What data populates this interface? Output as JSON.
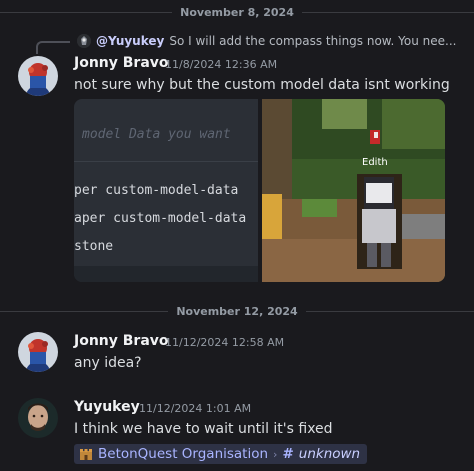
{
  "dividers": {
    "first": "November 8, 2024",
    "second": "November 12, 2024"
  },
  "reply": {
    "user": "@Yuyukey",
    "text": "So I will add the compass things now.  You nee..."
  },
  "messages": [
    {
      "author": "Jonny Bravo",
      "timestamp": "11/8/2024 12:36 AM",
      "text": "not sure why but the custom model data isnt working"
    },
    {
      "author": "Jonny Bravo",
      "timestamp": "11/12/2024 12:58 AM",
      "text": "any idea?"
    },
    {
      "author": "Yuyukey",
      "timestamp": "11/12/2024 1:01 AM",
      "text": "I think we have to wait until it's fixed"
    }
  ],
  "attachments": {
    "code": {
      "heading": "model Data you want",
      "lines": [
        "per custom-model-data",
        "aper custom-model-data",
        "stone"
      ]
    },
    "game": {
      "nametag": "Edith"
    }
  },
  "channel_mention": {
    "server": "BetonQuest Organisation",
    "channel": "unknown"
  },
  "icons": {
    "guild": "castle-icon",
    "hash": "hash-icon",
    "chevron": "chevron-right-icon"
  }
}
